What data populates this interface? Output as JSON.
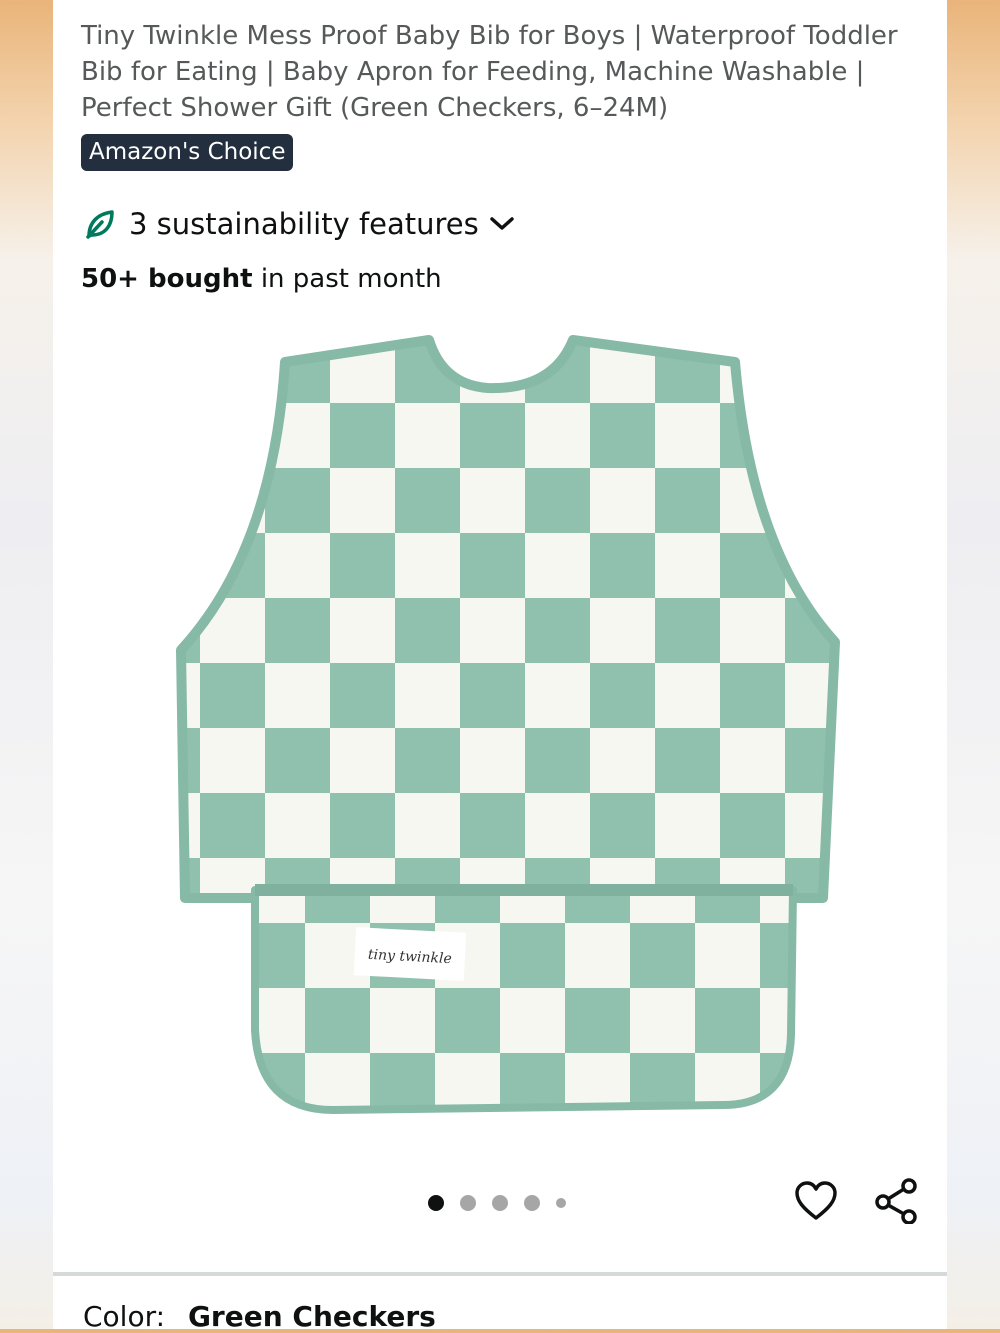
{
  "product": {
    "title": "Tiny Twinkle Mess Proof Baby Bib for Boys | Waterproof Toddler Bib for Eating | Baby Apron for Feeding, Machine Washable | Perfect Shower Gift (Green Checkers, 6–24M)",
    "badge": "Amazon's Choice",
    "sustainability": "3 sustainability features",
    "bought_count": "50+ bought",
    "bought_suffix": " in past month",
    "image_tag_text": "tiny twinkle",
    "color_label": "Color:",
    "color_value": "Green Checkers"
  },
  "carousel": {
    "total_dots": 5,
    "active_index": 0
  },
  "icons": {
    "leaf": "leaf-icon",
    "chevron": "chevron-down-icon",
    "heart": "heart-icon",
    "share": "share-icon"
  },
  "colors": {
    "badge_bg": "#232f3e",
    "checker_green": "#8fc1ae",
    "checker_white": "#f7f7f2",
    "leaf_green": "#007a5e"
  }
}
